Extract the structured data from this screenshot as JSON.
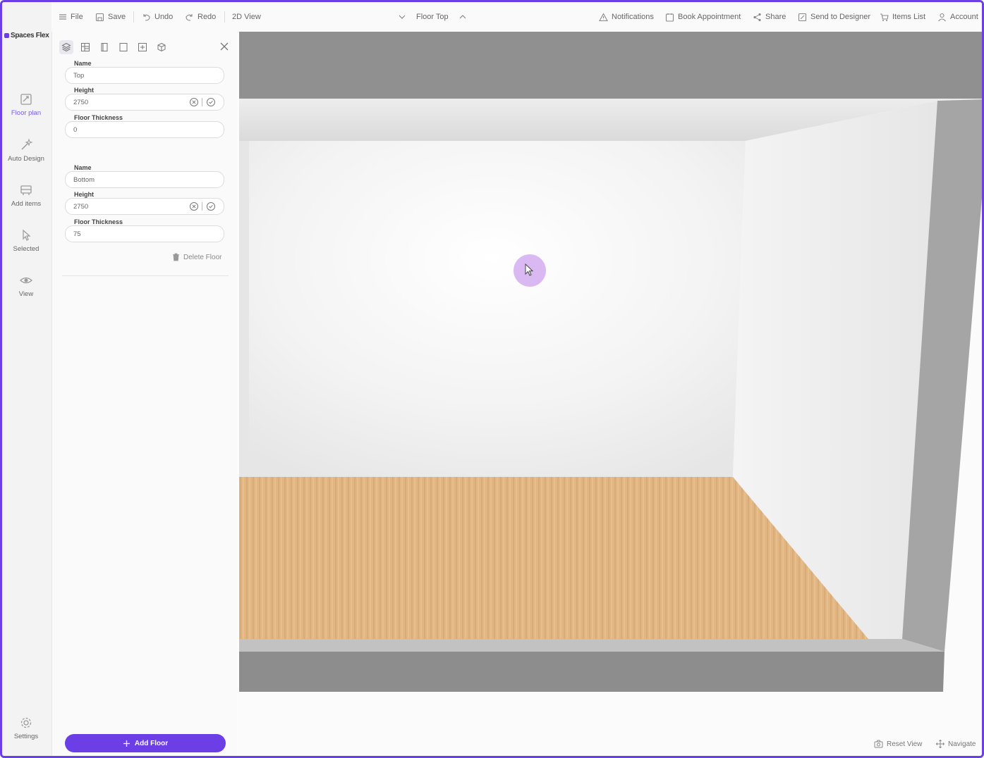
{
  "brand": {
    "name": "Spaces Flex",
    "accent": "#6c3fe6"
  },
  "toolbar": {
    "file": "File",
    "save": "Save",
    "undo": "Undo",
    "redo": "Redo",
    "view_toggle": "2D View",
    "floor_selector": "Floor Top",
    "notifications": "Notifications",
    "book_appointment": "Book Appointment",
    "share": "Share",
    "send_to_designer": "Send to Designer",
    "items_list": "Items List",
    "account": "Account"
  },
  "rail": {
    "items": [
      {
        "label": "Floor plan",
        "icon": "floor-plan-icon",
        "active": true
      },
      {
        "label": "Auto Design",
        "icon": "magic-wand-icon"
      },
      {
        "label": "Add items",
        "icon": "add-items-icon"
      },
      {
        "label": "Selected",
        "icon": "pointer-icon"
      },
      {
        "label": "View",
        "icon": "eye-icon"
      }
    ],
    "settings": "Settings"
  },
  "panel": {
    "tabs": [
      "layers-icon",
      "grid-icon",
      "door-icon",
      "window-icon",
      "panel-icon",
      "cube-icon"
    ],
    "floors": [
      {
        "name_label": "Name",
        "name_value": "Top",
        "height_label": "Height",
        "height_value": "2750",
        "thickness_label": "Floor Thickness",
        "thickness_value": "0"
      },
      {
        "name_label": "Name",
        "name_value": "Bottom",
        "height_label": "Height",
        "height_value": "2750",
        "thickness_label": "Floor Thickness",
        "thickness_value": "75"
      }
    ],
    "delete_floor": "Delete Floor",
    "add_floor": "Add Floor"
  },
  "viewport": {
    "reset_view": "Reset View",
    "navigate": "Navigate",
    "floor_color": "#e2b683",
    "wall_color": "#f2f2f2"
  }
}
